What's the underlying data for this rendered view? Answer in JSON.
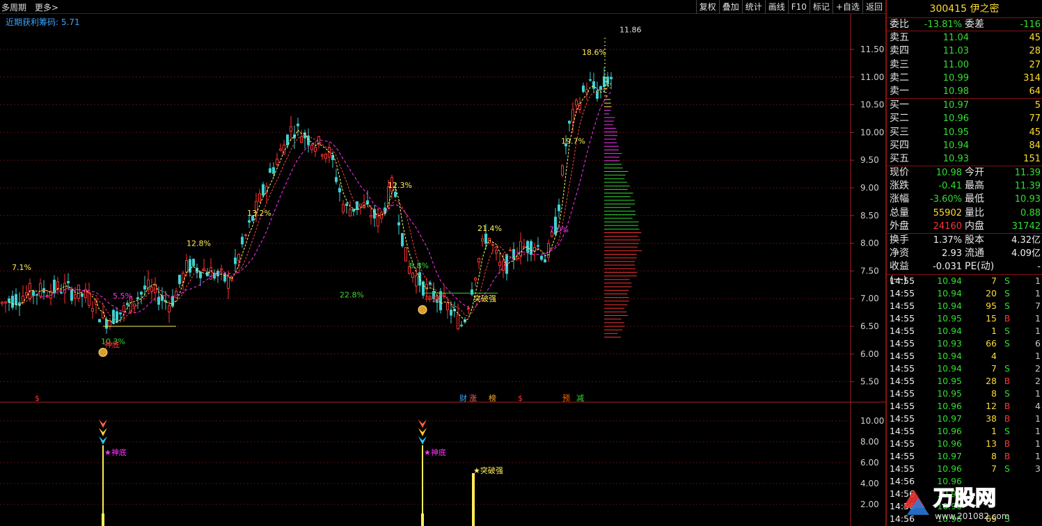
{
  "topbar": {
    "period_label": "多周期",
    "more_label": "更多>",
    "buttons": [
      "复权",
      "叠加",
      "统计",
      "画线",
      "F10",
      "标记",
      "+自选",
      "返回"
    ]
  },
  "indicator": {
    "title": "近期获利筹码: 5.71"
  },
  "chart": {
    "price_axis": [
      "11.50",
      "11.00",
      "10.50",
      "10.00",
      "9.50",
      "9.00",
      "8.50",
      "8.00",
      "7.50",
      "7.00",
      "6.50",
      "6.00",
      "5.50"
    ],
    "sub_axis": [
      "10.00",
      "8.00",
      "6.00",
      "4.00",
      "2.00"
    ],
    "high_label": "11.86",
    "pct_labels": [
      "7.1%",
      "5.5%",
      "10.3%",
      "12.8%",
      "13.2%",
      "22.8%",
      "12.3%",
      "8.8%",
      "21.4%",
      "7.0%",
      "19.7%",
      "18.6%"
    ],
    "signal_labels": [
      "神底",
      "神底",
      "突破强"
    ],
    "event_tags": [
      "$",
      "财",
      "涨",
      "榜",
      "$",
      "预",
      "减"
    ],
    "sub_labels": [
      "★神底",
      "★神底",
      "★突破强"
    ],
    "colors": {
      "up": "#ff3333",
      "down": "#3fd0d0",
      "ma5": "#ffff66",
      "ma10": "#ff4444",
      "ma20": "#ff33ff"
    }
  },
  "panel": {
    "code": "300415",
    "name": "伊之密",
    "weibi_label": "委比",
    "weibi": "-13.81%",
    "weicha_label": "委差",
    "weicha": "-116",
    "asks": [
      {
        "label": "卖五",
        "price": "11.04",
        "vol": "45"
      },
      {
        "label": "卖四",
        "price": "11.03",
        "vol": "28"
      },
      {
        "label": "卖三",
        "price": "11.00",
        "vol": "27"
      },
      {
        "label": "卖二",
        "price": "10.99",
        "vol": "314"
      },
      {
        "label": "卖一",
        "price": "10.98",
        "vol": "64"
      }
    ],
    "bids": [
      {
        "label": "买一",
        "price": "10.97",
        "vol": "5"
      },
      {
        "label": "买二",
        "price": "10.96",
        "vol": "77"
      },
      {
        "label": "买三",
        "price": "10.95",
        "vol": "45"
      },
      {
        "label": "买四",
        "price": "10.94",
        "vol": "84"
      },
      {
        "label": "买五",
        "price": "10.93",
        "vol": "151"
      }
    ],
    "quote1": [
      {
        "l1": "现价",
        "v1": "10.98",
        "c1": "green",
        "l2": "今开",
        "v2": "11.39",
        "c2": "green"
      },
      {
        "l1": "涨跌",
        "v1": "-0.41",
        "c1": "green",
        "l2": "最高",
        "v2": "11.39",
        "c2": "green"
      },
      {
        "l1": "涨幅",
        "v1": "-3.60%",
        "c1": "green",
        "l2": "最低",
        "v2": "10.93",
        "c2": "green"
      },
      {
        "l1": "总量",
        "v1": "55902",
        "c1": "yellow",
        "l2": "量比",
        "v2": "0.88",
        "c2": "green"
      },
      {
        "l1": "外盘",
        "v1": "24160",
        "c1": "red",
        "l2": "内盘",
        "v2": "31742",
        "c2": "green"
      }
    ],
    "quote2": [
      {
        "l1": "换手",
        "v1": "1.37%",
        "c1": "white",
        "l2": "股本",
        "v2": "4.32亿",
        "c2": "white"
      },
      {
        "l1": "净资",
        "v1": "2.93",
        "c1": "white",
        "l2": "流通",
        "v2": "4.09亿",
        "c2": "white"
      },
      {
        "l1": "收益(一)",
        "v1": "-0.031",
        "c1": "white",
        "l2": "PE(动)",
        "v2": "-",
        "c2": "white"
      }
    ],
    "ticks": [
      {
        "t": "14:55",
        "p": "10.94",
        "v": "7",
        "s": "S",
        "x": "1"
      },
      {
        "t": "14:55",
        "p": "10.94",
        "v": "20",
        "s": "S",
        "x": "1"
      },
      {
        "t": "14:55",
        "p": "10.94",
        "v": "95",
        "s": "S",
        "x": "7"
      },
      {
        "t": "14:55",
        "p": "10.95",
        "v": "15",
        "s": "B",
        "x": "1"
      },
      {
        "t": "14:55",
        "p": "10.94",
        "v": "1",
        "s": "S",
        "x": "1"
      },
      {
        "t": "14:55",
        "p": "10.93",
        "v": "66",
        "s": "S",
        "x": "6"
      },
      {
        "t": "14:55",
        "p": "10.94",
        "v": "4",
        "s": "",
        "x": "1"
      },
      {
        "t": "14:55",
        "p": "10.94",
        "v": "7",
        "s": "S",
        "x": "2"
      },
      {
        "t": "14:55",
        "p": "10.95",
        "v": "28",
        "s": "B",
        "x": "2"
      },
      {
        "t": "14:55",
        "p": "10.95",
        "v": "8",
        "s": "S",
        "x": "1"
      },
      {
        "t": "14:55",
        "p": "10.96",
        "v": "12",
        "s": "B",
        "x": "4"
      },
      {
        "t": "14:55",
        "p": "10.97",
        "v": "38",
        "s": "B",
        "x": "1"
      },
      {
        "t": "14:55",
        "p": "10.96",
        "v": "1",
        "s": "S",
        "x": "1"
      },
      {
        "t": "14:55",
        "p": "10.96",
        "v": "13",
        "s": "B",
        "x": "1"
      },
      {
        "t": "14:55",
        "p": "10.97",
        "v": "8",
        "s": "B",
        "x": "1"
      },
      {
        "t": "14:55",
        "p": "10.96",
        "v": "7",
        "s": "S",
        "x": "3"
      },
      {
        "t": "14:56",
        "p": "10.96",
        "v": "",
        "s": "",
        "x": ""
      },
      {
        "t": "14:56",
        "p": "10.96",
        "v": "",
        "s": "",
        "x": ""
      },
      {
        "t": "14:56",
        "p": "10.96",
        "v": "",
        "s": "",
        "x": ""
      },
      {
        "t": "14:56",
        "p": "10.96",
        "v": "69",
        "s": "S",
        "x": ""
      }
    ],
    "watermark": {
      "brand": "万股网",
      "url": "www.201082.com"
    }
  }
}
